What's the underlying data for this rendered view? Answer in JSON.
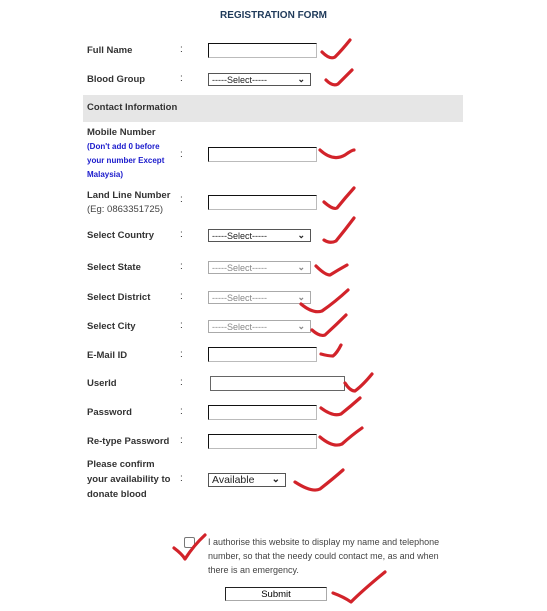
{
  "form": {
    "title": "REGISTRATION FORM",
    "colon": ":",
    "fields": {
      "full_name": {
        "label": "Full Name",
        "value": ""
      },
      "blood_group": {
        "label": "Blood Group",
        "selected": "-----Select-----"
      },
      "section_contact": "Contact Information",
      "mobile": {
        "label": "Mobile Number",
        "note_lines": [
          "(Don't add 0 before",
          "your number Except",
          "Malaysia)"
        ],
        "value": ""
      },
      "landline": {
        "label": "Land Line Number",
        "note": "(Eg: 0863351725)",
        "value": ""
      },
      "country": {
        "label": "Select Country",
        "selected": "-----Select-----"
      },
      "state": {
        "label": "Select State",
        "selected": "-----Select-----",
        "disabled": true
      },
      "district": {
        "label": "Select District",
        "selected": "-----Select-----",
        "disabled": true
      },
      "city": {
        "label": "Select City",
        "selected": "-----Select-----",
        "disabled": true
      },
      "email": {
        "label": "E-Mail ID",
        "value": ""
      },
      "userid": {
        "label": "UserId",
        "value": ""
      },
      "password": {
        "label": "Password",
        "value": ""
      },
      "retype_password": {
        "label": "Re-type Password",
        "value": ""
      },
      "availability": {
        "label_lines": [
          "Please confirm",
          "your availability to",
          "donate blood"
        ],
        "selected": "Available"
      }
    },
    "consent": {
      "lines": [
        "I authorise this website to display my name and telephone",
        "number, so that the needy could contact me, as and when",
        "there is an emergency."
      ],
      "checked": false
    },
    "submit_label": "Submit",
    "chevron": "⌄",
    "annotation_color": "#d2232a"
  }
}
